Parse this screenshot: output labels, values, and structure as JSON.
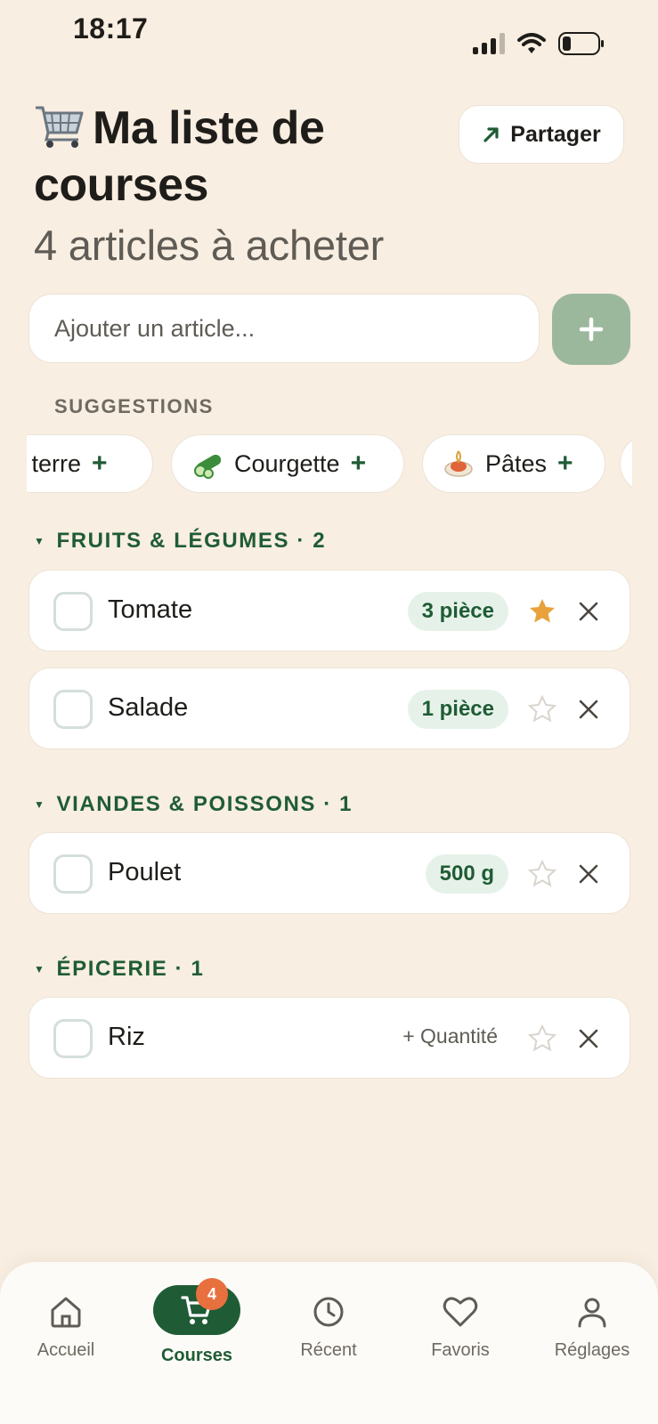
{
  "status": {
    "time": "18:17"
  },
  "header": {
    "title": "Ma liste de courses",
    "subtitle": "4 articles à acheter",
    "share_label": "Partager"
  },
  "add": {
    "placeholder": "Ajouter un article..."
  },
  "suggestions": {
    "label": "SUGGESTIONS",
    "chips": [
      {
        "label": "e terre",
        "icon": "potato-icon"
      },
      {
        "label": "Courgette",
        "icon": "cucumber-icon"
      },
      {
        "label": "Pâtes",
        "icon": "spaghetti-icon"
      }
    ]
  },
  "sections": [
    {
      "title": "FRUITS & LÉGUMES · 2",
      "items": [
        {
          "name": "Tomate",
          "qty": "3 pièce",
          "favorite": true
        },
        {
          "name": "Salade",
          "qty": "1 pièce",
          "favorite": false
        }
      ]
    },
    {
      "title": "VIANDES & POISSONS · 1",
      "items": [
        {
          "name": "Poulet",
          "qty": "500 g",
          "favorite": false
        }
      ]
    },
    {
      "title": "ÉPICERIE · 1",
      "items": [
        {
          "name": "Riz",
          "qty_placeholder": "+ Quantité",
          "favorite": false
        }
      ]
    }
  ],
  "tabbar": {
    "tabs": [
      {
        "label": "Accueil",
        "icon": "home-icon"
      },
      {
        "label": "Courses",
        "icon": "cart-icon",
        "active": true,
        "badge": "4"
      },
      {
        "label": "Récent",
        "icon": "clock-icon"
      },
      {
        "label": "Favoris",
        "icon": "heart-icon"
      },
      {
        "label": "Réglages",
        "icon": "user-icon"
      }
    ]
  },
  "colors": {
    "background": "#f8eee1",
    "accent_green": "#1f5c35",
    "qty_pill_bg": "#e6f2e9",
    "favorite_star": "#e9a23b",
    "badge": "#e8703e",
    "add_button": "#9cb89c"
  }
}
